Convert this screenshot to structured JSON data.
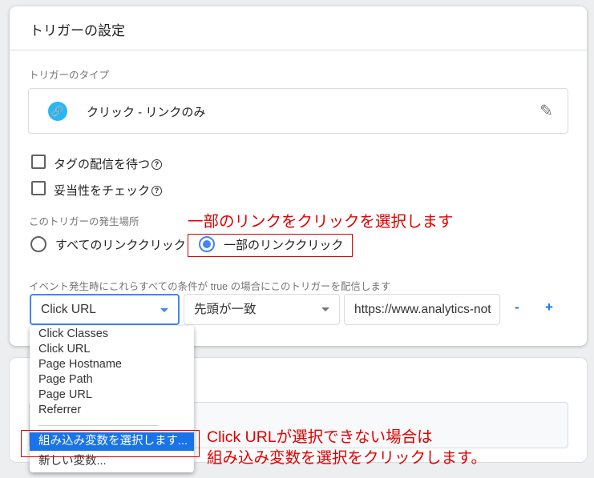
{
  "card": {
    "title": "トリガーの設定",
    "type_label": "トリガーのタイプ",
    "type_value": "クリック - リンクのみ",
    "type_icon": "link-icon",
    "edit_icon": "pencil-icon"
  },
  "checkboxes": [
    {
      "label": "タグの配信を待つ",
      "checked": false
    },
    {
      "label": "妥当性をチェック",
      "checked": false
    }
  ],
  "fire_on": {
    "label": "このトリガーの発生場所",
    "options": [
      {
        "label": "すべてのリンククリック",
        "selected": false
      },
      {
        "label": "一部のリンククリック",
        "selected": true
      }
    ]
  },
  "condition": {
    "label": "イベント発生時にこれらすべての条件が true の場合にこのトリガーを配信します",
    "variable": "Click URL",
    "operator": "先頭が一致",
    "value": "https://www.analytics-not",
    "remove": "-",
    "add": "+"
  },
  "dropdown": {
    "items": [
      "Click Classes",
      "Click URL",
      "Page Hostname",
      "Page Path",
      "Page URL",
      "Referrer"
    ],
    "builtin": "組み込み変数を選択します...",
    "new_var": "新しい変数..."
  },
  "annotations": {
    "a1": "一部のリンクをクリックを選択します",
    "a2_line1": "Click URLが選択できない場合は",
    "a2_line2": "組み込み変数を選択をクリックします。"
  },
  "colors": {
    "accent": "#4285f4",
    "annotation": "#e00000",
    "link_icon": "#29b6f6",
    "highlight": "#1a73e8"
  }
}
